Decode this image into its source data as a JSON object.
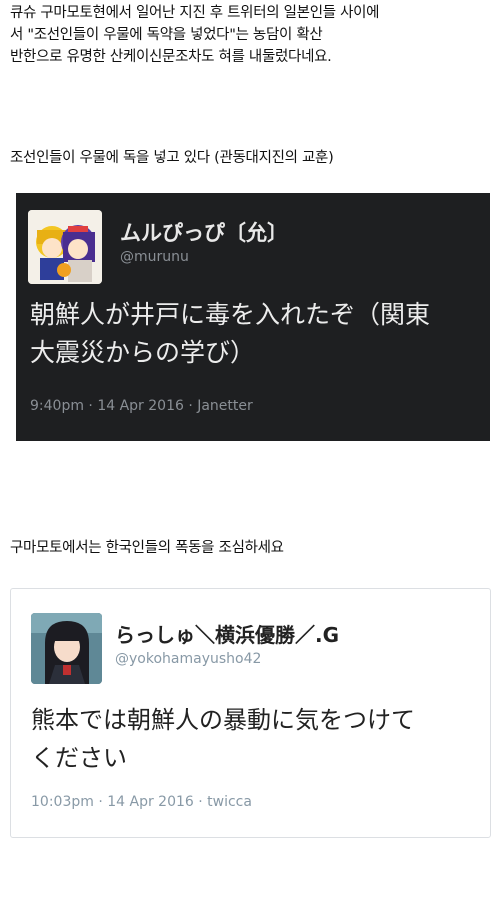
{
  "intro": {
    "line1": "큐슈 구마모토현에서 일어난 지진 후 트위터의 일본인들 사이에",
    "line2": "서 \"조선인들이 우물에 독약을 넣었다\"는 농담이 확산",
    "line3": "반한으로 유명한 산케이신문조차도 혀를 내둘렀다네요."
  },
  "caption1": "조선인들이 우물에 독을 넣고 있다 (관동대지진의 교훈)",
  "tweet1": {
    "name": "ムルぴっぴ〔允〕",
    "handle": "@murunu",
    "text_line1": "朝鮮人が井戸に毒を入れたぞ（関東",
    "text_line2": "大震災からの学び）",
    "meta": "9:40pm · 14 Apr 2016 · Janetter"
  },
  "caption2": "구마모토에서는 한국인들의 폭동을 조심하세요",
  "tweet2": {
    "name": "らっしゅ＼横浜優勝／.G",
    "handle": "@yokohamayusho42",
    "text_line1": "熊本では朝鮮人の暴動に気をつけて",
    "text_line2": "ください",
    "meta": "10:03pm · 14 Apr 2016 · twicca"
  }
}
